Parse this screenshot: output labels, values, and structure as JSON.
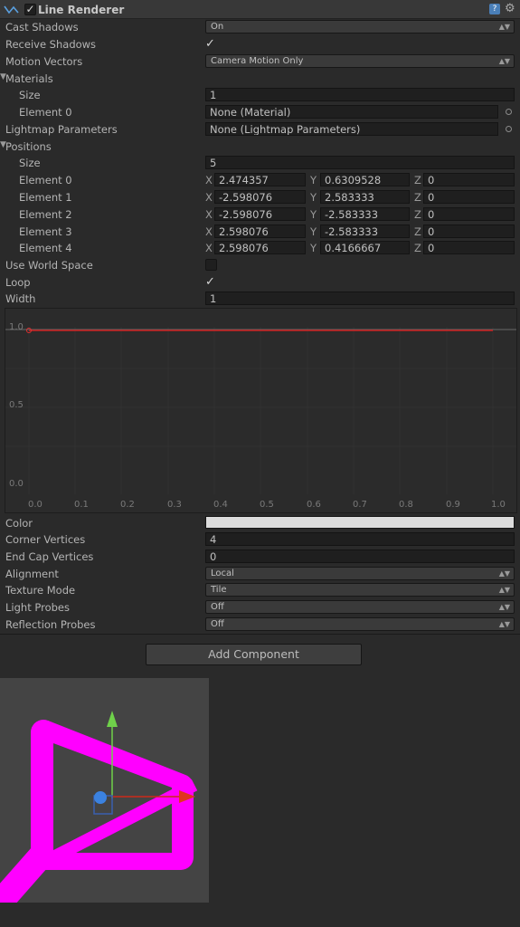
{
  "component": {
    "title": "Line Renderer",
    "enabled": true
  },
  "fields": {
    "cast_shadows": {
      "label": "Cast Shadows",
      "value": "On"
    },
    "receive_shadows": {
      "label": "Receive Shadows",
      "checked": true
    },
    "motion_vectors": {
      "label": "Motion Vectors",
      "value": "Camera Motion Only"
    },
    "materials": {
      "label": "Materials",
      "size_label": "Size",
      "size": "1",
      "element0_label": "Element 0",
      "element0": "None (Material)"
    },
    "lightmap": {
      "label": "Lightmap Parameters",
      "value": "None (Lightmap Parameters)"
    },
    "positions": {
      "label": "Positions",
      "size_label": "Size",
      "size": "5",
      "elements": [
        {
          "label": "Element 0",
          "x": "2.474357",
          "y": "0.6309528",
          "z": "0"
        },
        {
          "label": "Element 1",
          "x": "-2.598076",
          "y": "2.583333",
          "z": "0"
        },
        {
          "label": "Element 2",
          "x": "-2.598076",
          "y": "-2.583333",
          "z": "0"
        },
        {
          "label": "Element 3",
          "x": "2.598076",
          "y": "-2.583333",
          "z": "0"
        },
        {
          "label": "Element 4",
          "x": "2.598076",
          "y": "0.4166667",
          "z": "0"
        }
      ],
      "axis_x": "X",
      "axis_y": "Y",
      "axis_z": "Z"
    },
    "use_world_space": {
      "label": "Use World Space",
      "checked": false
    },
    "loop": {
      "label": "Loop",
      "checked": true
    },
    "width": {
      "label": "Width",
      "value": "1"
    },
    "color": {
      "label": "Color",
      "value": "#dcdcdc"
    },
    "corner_vertices": {
      "label": "Corner Vertices",
      "value": "4"
    },
    "end_cap_vertices": {
      "label": "End Cap Vertices",
      "value": "0"
    },
    "alignment": {
      "label": "Alignment",
      "value": "Local"
    },
    "texture_mode": {
      "label": "Texture Mode",
      "value": "Tile"
    },
    "light_probes": {
      "label": "Light Probes",
      "value": "Off"
    },
    "reflection_probes": {
      "label": "Reflection Probes",
      "value": "Off"
    }
  },
  "curve": {
    "y_ticks": [
      "1.0",
      "0.5",
      "0.0"
    ],
    "x_ticks": [
      "0.0",
      "0.1",
      "0.2",
      "0.3",
      "0.4",
      "0.5",
      "0.6",
      "0.7",
      "0.8",
      "0.9",
      "1.0"
    ],
    "key_value": 1.0,
    "line_color": "#cc1f1f"
  },
  "add_component": {
    "label": "Add Component"
  },
  "preview": {
    "line_color": "#ff00ff",
    "background": "#444444"
  },
  "icons": {
    "component_icon": "line-renderer-icon",
    "help_icon": "help-icon",
    "gear_icon": "gear-icon",
    "object_picker": "object-picker-icon"
  }
}
